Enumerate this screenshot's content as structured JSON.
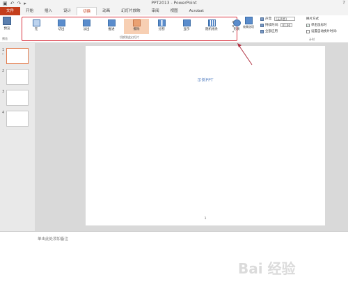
{
  "titlebar": {
    "title": "PPT2013 - PowerPoint",
    "help": "?",
    "qat": [
      "save-icon",
      "undo-icon",
      "redo-icon",
      "start-from-beginning-icon"
    ]
  },
  "tabs": [
    {
      "label": "文件",
      "active": false,
      "file": true
    },
    {
      "label": "开始",
      "active": false
    },
    {
      "label": "插入",
      "active": false
    },
    {
      "label": "设计",
      "active": false
    },
    {
      "label": "切换",
      "active": true
    },
    {
      "label": "动画",
      "active": false
    },
    {
      "label": "幻灯片放映",
      "active": false
    },
    {
      "label": "审阅",
      "active": false
    },
    {
      "label": "视图",
      "active": false
    },
    {
      "label": "Acrobat",
      "active": false
    }
  ],
  "ribbon": {
    "preview": {
      "label": "预览",
      "group_label": "预览"
    },
    "transitions": {
      "group_label": "切换到此幻灯片",
      "items": [
        {
          "label": "无",
          "icon": "none-transition-icon",
          "selected": false
        },
        {
          "label": "切出",
          "icon": "cut-transition-icon",
          "selected": false
        },
        {
          "label": "淡出",
          "icon": "fade-transition-icon",
          "selected": false
        },
        {
          "label": "推进",
          "icon": "push-transition-icon",
          "selected": false
        },
        {
          "label": "擦除",
          "icon": "wipe-transition-icon",
          "selected": true
        },
        {
          "label": "分割",
          "icon": "split-transition-icon",
          "selected": false
        },
        {
          "label": "显示",
          "icon": "reveal-transition-icon",
          "selected": false
        },
        {
          "label": "随机线条",
          "icon": "random-bars-transition-icon",
          "selected": false
        },
        {
          "label": "形状",
          "icon": "shape-transition-icon",
          "selected": false
        }
      ]
    },
    "effect_options": {
      "label": "效果选项"
    },
    "timing": {
      "sound_label": "声音:",
      "sound_value": "[无声音]",
      "duration_label": "持续时间:",
      "duration_value": "01.00",
      "apply_all_label": "全部应用",
      "advance_label": "换片方式",
      "on_click_label": "单击鼠标时",
      "on_click_checked": true,
      "after_label": "设置自动换片时间:",
      "after_value": "00:00.00",
      "after_checked": false,
      "group_label": "计时"
    }
  },
  "thumbnails": [
    {
      "num": "1",
      "selected": true,
      "star": "*"
    },
    {
      "num": "2",
      "selected": false,
      "star": ""
    },
    {
      "num": "3",
      "selected": false,
      "star": ""
    },
    {
      "num": "4",
      "selected": false,
      "star": ""
    }
  ],
  "slide": {
    "title": "示例PPT",
    "number": "1"
  },
  "notes": {
    "placeholder": "单击此处添加备注"
  },
  "watermark": "Bai 经验"
}
